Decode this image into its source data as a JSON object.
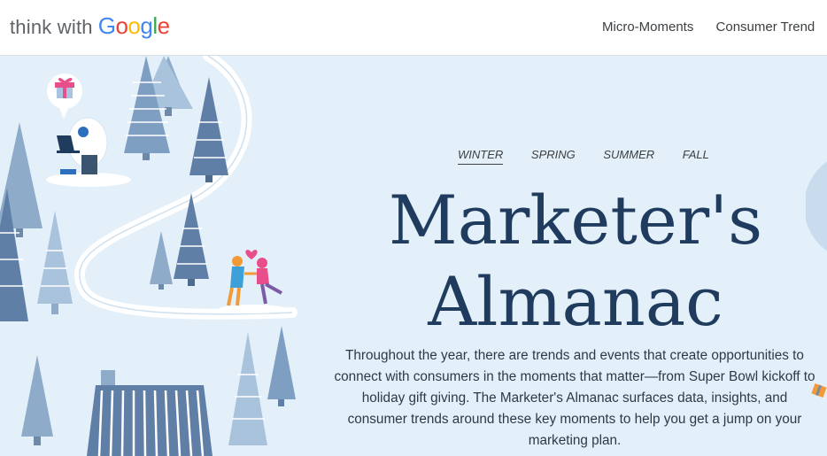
{
  "header": {
    "logo_prefix": "think with",
    "logo_letters": [
      {
        "char": "G",
        "color": "#4285F4"
      },
      {
        "char": "o",
        "color": "#EA4335"
      },
      {
        "char": "o",
        "color": "#FBBC05"
      },
      {
        "char": "g",
        "color": "#4285F4"
      },
      {
        "char": "l",
        "color": "#34A853"
      },
      {
        "char": "e",
        "color": "#EA4335"
      }
    ],
    "nav": [
      "Micro-Moments",
      "Consumer Trend"
    ]
  },
  "hero": {
    "seasons": [
      "WINTER",
      "SPRING",
      "SUMMER",
      "FALL"
    ],
    "active_season": "WINTER",
    "title_line1": "Marketer's",
    "title_line2": "Almanac",
    "description": "Throughout the year, there are trends and events that create opportunities to connect with consumers in the moments that matter—from Super Bowl kickoff to holiday gift giving. The Marketer's Almanac surfaces data, insights, and consumer trends around these key moments to help you get a jump on your marketing plan."
  },
  "colors": {
    "title": "#1f3b5e",
    "hero_bg": "#e4f0f9",
    "tree_dark": "#5f7fa6",
    "tree_light": "#a9c3dd"
  },
  "icons": [
    "gift-icon",
    "yeti-with-laptop",
    "skating-couple",
    "heart-icon",
    "cabin",
    "pine-tree"
  ]
}
